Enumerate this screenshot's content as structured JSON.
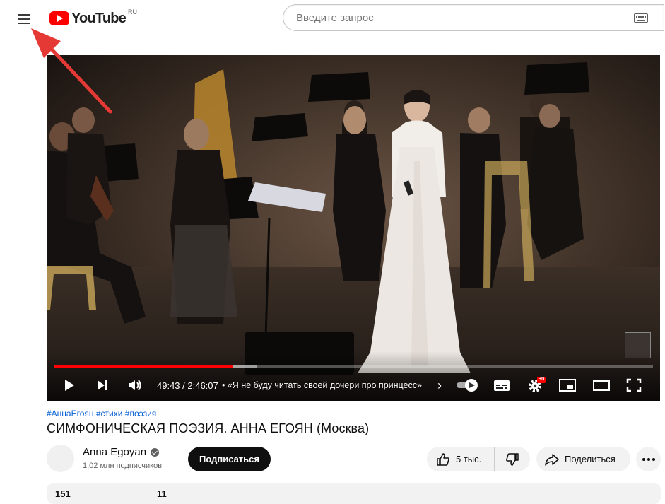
{
  "header": {
    "logo_text": "YouTube",
    "region": "RU",
    "search_placeholder": "Введите запрос"
  },
  "player": {
    "time": "49:43 / 2:46:07",
    "chapter": "• «Я не буду читать своей дочери про принцесс»",
    "chapter_arrow": "›",
    "progress_played": 0.3,
    "progress_loaded": 0.34,
    "settings_badge": "HD"
  },
  "video": {
    "hashtags": "#АннаЕгоян #стихи #поэзия",
    "title": "СИМФОНИЧЕСКАЯ ПОЭЗИЯ. АННА ЕГОЯН (Москва)"
  },
  "channel": {
    "name": "Anna Egoyan",
    "subscribers": "1,02 млн подписчиков",
    "subscribe_label": "Подписаться"
  },
  "actions": {
    "likes": "5 тыс.",
    "share_label": "Поделиться"
  },
  "description": {
    "views": "151",
    "date": "11"
  },
  "colors": {
    "brand_red": "#ff0000",
    "link_blue": "#065fd4",
    "annotation_red": "#e53935"
  }
}
